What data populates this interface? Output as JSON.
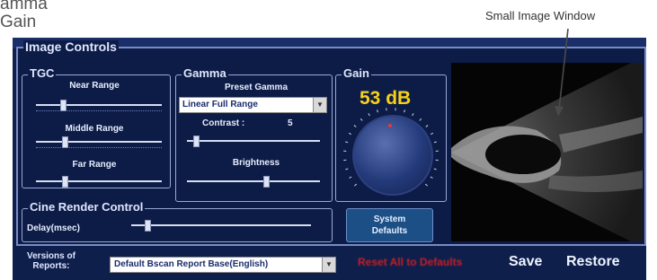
{
  "doc_text": {
    "line1": "amma",
    "line2": "Gain"
  },
  "callout": {
    "label": "Small Image Window"
  },
  "image_controls": {
    "title": "Image Controls",
    "tgc": {
      "title": "TGC",
      "near_label": "Near Range",
      "middle_label": "Middle Range",
      "far_label": "Far Range",
      "near_level": 0.2,
      "middle_level": 0.22,
      "far_level": 0.22
    },
    "gamma": {
      "title": "Gamma",
      "preset_label": "Preset Gamma",
      "preset_value": "Linear Full Range",
      "contrast_label": "Contrast :",
      "contrast_value": "5",
      "contrast_level": 0.05,
      "brightness_label": "Brightness",
      "brightness_level": 0.6
    },
    "gain": {
      "title": "Gain",
      "value": "53 dB"
    },
    "cine": {
      "title": "Cine Render Control",
      "delay_label": "Delay(msec)",
      "delay_level": 0.08
    },
    "system_defaults": {
      "line1": "System",
      "line2": "Defaults"
    }
  },
  "bottom": {
    "versions_line1": "Versions of",
    "versions_line2": "Reports:",
    "report_value": "Default Bscan Report Base(English)",
    "reset_label": "Reset All to Defaults",
    "save_label": "Save",
    "restore_label": "Restore"
  },
  "colors": {
    "panel": "#0d1c46",
    "gain_text": "#f7d21a",
    "reset_text": "#c42027"
  },
  "icons": {
    "dropdown": "dropdown-arrow-icon",
    "callout": "callout-arrow-icon"
  }
}
